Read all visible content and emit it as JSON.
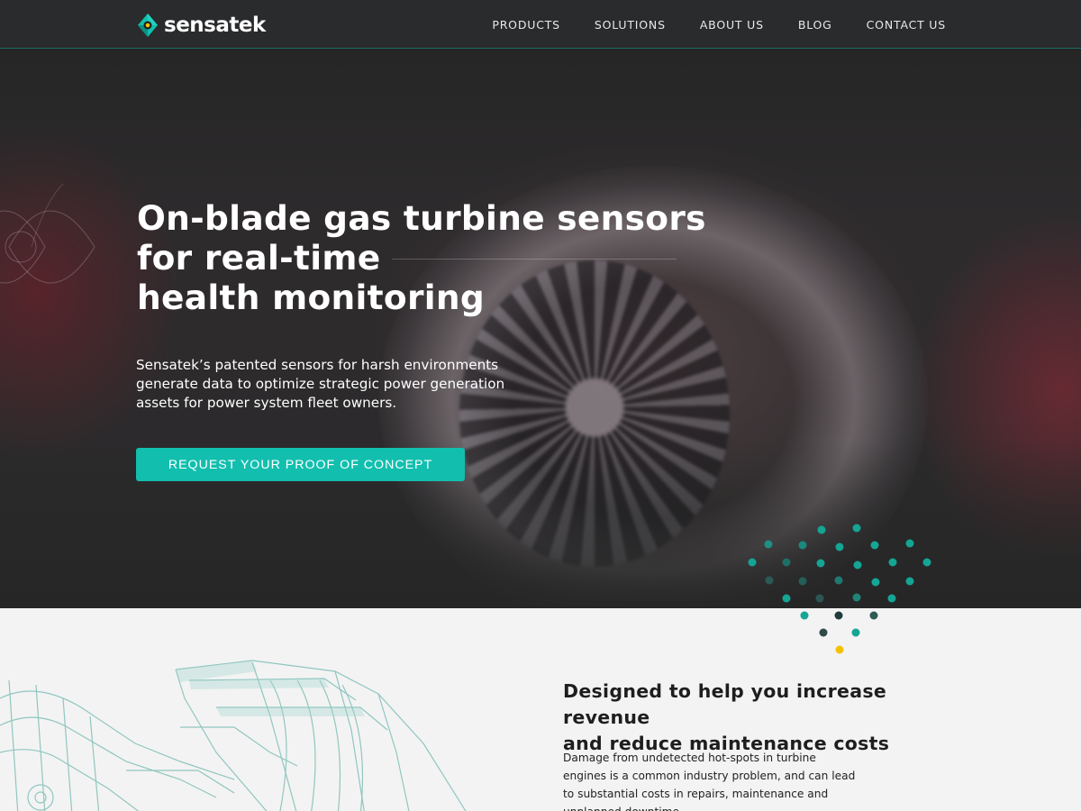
{
  "brand": {
    "name": "sensatek",
    "accent": "#12bfae"
  },
  "nav": {
    "links": [
      "PRODUCTS",
      "SOLUTIONS",
      "ABOUT US",
      "BLOG",
      "CONTACT US"
    ]
  },
  "hero": {
    "title_lines": [
      "On-blade gas turbine sensors",
      "for real-time",
      "health monitoring"
    ],
    "subtitle": "Sensatek’s patented sensors for harsh environments generate data to optimize strategic power generation assets for power system fleet owners.",
    "cta_label": "REQUEST YOUR PROOF OF CONCEPT"
  },
  "section": {
    "title_lines": [
      "Designed to help you increase revenue",
      "and reduce maintenance costs"
    ],
    "body": "Damage from undetected hot-spots in turbine engines is a common industry problem, and can lead to substantial costs in repairs, maintenance and unplanned downtime."
  },
  "icons": [
    "sensatek-logo-icon",
    "lens-outline-icon",
    "dot-matrix-graphic",
    "turbine-wireframe-illustration"
  ]
}
